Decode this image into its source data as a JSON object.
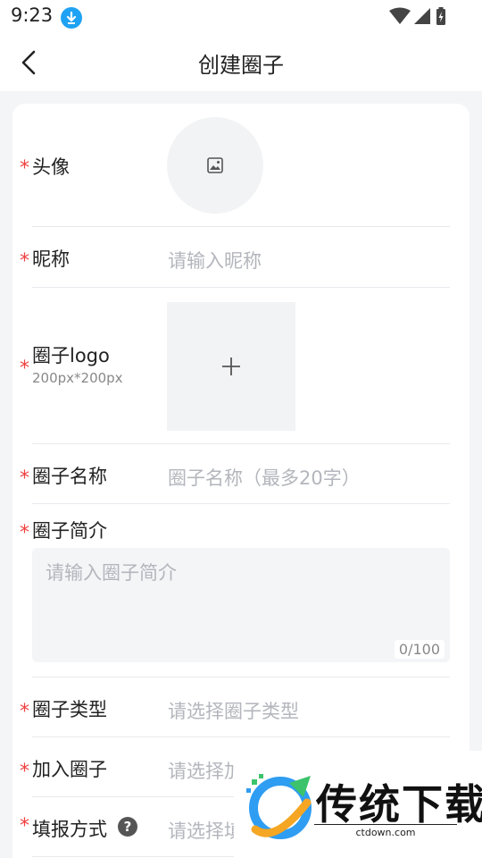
{
  "status_bar": {
    "time": "9:23",
    "icons": [
      "download-icon",
      "wifi-icon",
      "signal-icon",
      "battery-icon"
    ]
  },
  "nav": {
    "back_icon": "chevron-left-icon",
    "title": "创建圈子"
  },
  "form": {
    "avatar": {
      "label": "头像",
      "required": true,
      "icon": "image-icon"
    },
    "nickname": {
      "label": "昵称",
      "required": true,
      "placeholder": "请输入昵称"
    },
    "logo": {
      "label": "圈子logo",
      "hint": "200px*200px",
      "required": true,
      "icon": "plus-icon"
    },
    "name": {
      "label": "圈子名称",
      "required": true,
      "placeholder": "圈子名称（最多20字）"
    },
    "intro": {
      "label": "圈子简介",
      "required": true,
      "placeholder": "请输入圈子简介",
      "counter": "0/100"
    },
    "type": {
      "label": "圈子类型",
      "required": true,
      "placeholder": "请选择圈子类型"
    },
    "join": {
      "label": "加入圈子",
      "required": true,
      "placeholder": "请选择加"
    },
    "report": {
      "label": "填报方式",
      "required": true,
      "placeholder": "请选择填",
      "help_icon": "question-icon"
    }
  },
  "watermark": {
    "brand": "传统下载",
    "url": "ctdown.com"
  },
  "colors": {
    "required_star": "#f04040",
    "placeholder": "#b3b6bc",
    "download_badge": "#1fa2f3"
  }
}
